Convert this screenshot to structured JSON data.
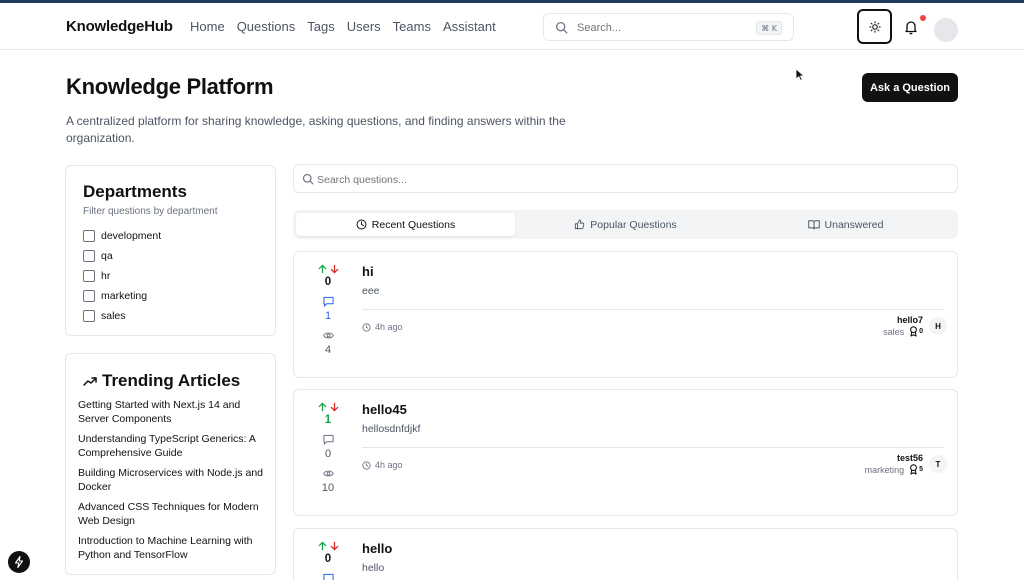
{
  "header": {
    "brand": "KnowledgeHub",
    "nav": [
      "Home",
      "Questions",
      "Tags",
      "Users",
      "Teams",
      "Assistant"
    ],
    "search_placeholder": "Search...",
    "search_shortcut": "⌘ K"
  },
  "page": {
    "title": "Knowledge Platform",
    "description": "A centralized platform for sharing knowledge, asking questions, and finding answers within the organization.",
    "ask_label": "Ask a Question"
  },
  "departments": {
    "title": "Departments",
    "subtitle": "Filter questions by department",
    "items": [
      "development",
      "qa",
      "hr",
      "marketing",
      "sales"
    ]
  },
  "trending": {
    "title": "Trending Articles",
    "items": [
      "Getting Started with Next.js 14 and Server Components",
      "Understanding TypeScript Generics: A Comprehensive Guide",
      "Building Microservices with Node.js and Docker",
      "Advanced CSS Techniques for Modern Web Design",
      "Introduction to Machine Learning with Python and TensorFlow"
    ]
  },
  "questions_search_placeholder": "Search questions...",
  "tabs": [
    "Recent Questions",
    "Popular Questions",
    "Unanswered"
  ],
  "questions": [
    {
      "title": "hi",
      "body": "eee",
      "score": "0",
      "answers": "1",
      "views": "4",
      "time": "4h ago",
      "author": "hello7",
      "department": "sales",
      "reputation": "0",
      "initial": "H"
    },
    {
      "title": "hello45",
      "body": "hellosdnfdjkf",
      "score": "1",
      "answers": "0",
      "views": "10",
      "time": "4h ago",
      "author": "test56",
      "department": "marketing",
      "reputation": "5",
      "initial": "T"
    },
    {
      "title": "hello",
      "body": "hello",
      "score": "0"
    }
  ],
  "colors": {
    "accent": "#111111",
    "upvote": "#16a34a",
    "downvote": "#dc2626",
    "answered": "#2563eb",
    "notification": "#ef4444"
  }
}
